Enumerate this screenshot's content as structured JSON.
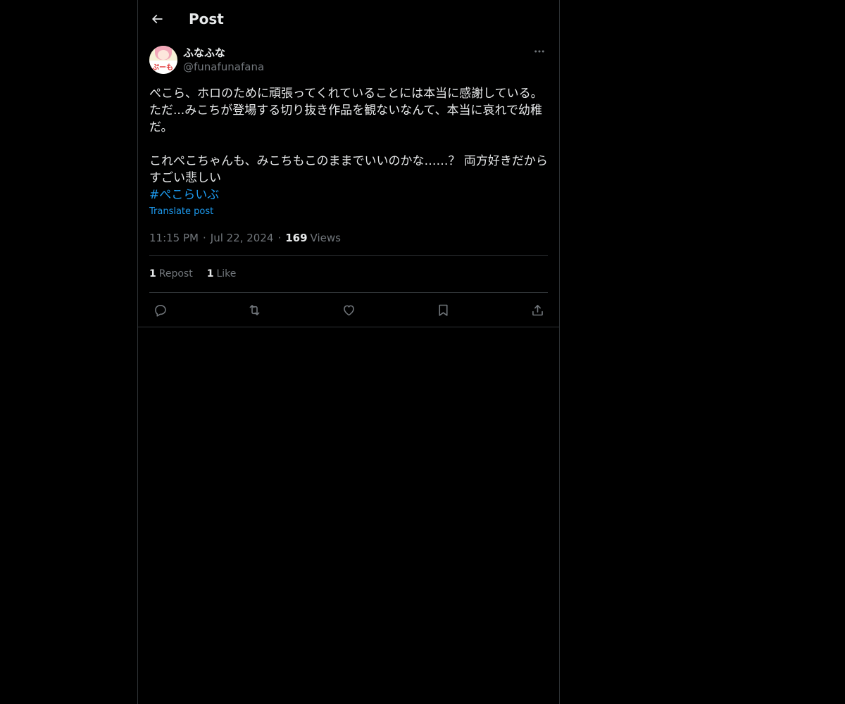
{
  "header": {
    "title": "Post",
    "back_icon": "arrow-left-icon"
  },
  "post": {
    "author": {
      "display_name": "ふなふな",
      "handle": "@funafunafana",
      "avatar_text": "ぷーも",
      "avatar_colors": {
        "background": "#f6f1d6",
        "hair": "#f2a7b8"
      }
    },
    "more_icon": "ellipsis-icon",
    "text": "ぺこら、ホロのために頑張ってくれていることには本当に感謝している。ただ...みこちが登場する切り抜き作品を観ないなんて、本当に哀れで幼稚だ。\n\nこれぺこちゃんも、みこちもこのままでいいのかな……？ 両方好きだからすごい悲しい",
    "hashtag": "#ぺこらいぶ",
    "translate_label": "Translate post",
    "time": "11:15 PM",
    "separator": "·",
    "date": "Jul 22, 2024",
    "views_count": "169",
    "views_label": "Views",
    "stats": {
      "reposts_count": "1",
      "reposts_label": "Repost",
      "likes_count": "1",
      "likes_label": "Like"
    },
    "actions": [
      "reply-icon",
      "repost-icon",
      "like-icon",
      "bookmark-icon",
      "share-icon"
    ]
  },
  "colors": {
    "background": "#000000",
    "border": "#2f3336",
    "text_primary": "#e7e9ea",
    "text_secondary": "#71767b",
    "accent": "#1d9bf0"
  }
}
